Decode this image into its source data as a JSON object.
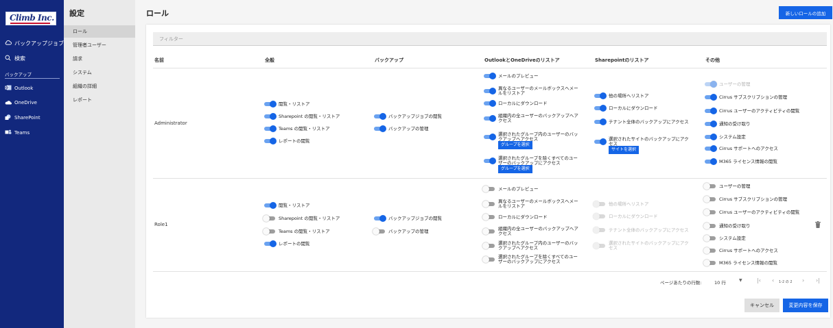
{
  "sidebar": {
    "logo_text": "Climb Inc.",
    "nav": [
      {
        "label": "バックアップジョブ",
        "icon": "cloud-sync-icon"
      },
      {
        "label": "検索",
        "icon": "search-icon"
      }
    ],
    "section_label": "バックアップ",
    "services": [
      {
        "label": "Outlook",
        "icon": "outlook-icon"
      },
      {
        "label": "OneDrive",
        "icon": "onedrive-icon"
      },
      {
        "label": "SharePoint",
        "icon": "sharepoint-icon"
      },
      {
        "label": "Teams",
        "icon": "teams-icon"
      }
    ]
  },
  "subnav": {
    "title": "設定",
    "items": [
      {
        "label": "ロール",
        "active": true
      },
      {
        "label": "管理者ユーザー"
      },
      {
        "label": "請求"
      },
      {
        "label": "システム"
      },
      {
        "label": "組織の詳細"
      },
      {
        "label": "レポート"
      }
    ]
  },
  "main": {
    "title": "ロール",
    "add_role_label": "新しいロールの追加",
    "filter_placeholder": "フィルター",
    "columns": [
      "名前",
      "全般",
      "バックアップ",
      "OutlookとOneDriveのリストア",
      "Sharepointのリストア",
      "その他"
    ],
    "roles": [
      {
        "name": "Administrator",
        "general": [
          {
            "label": "閲覧・リストア",
            "on": true
          },
          {
            "label": "Sharepoint の閲覧・リストア",
            "on": true
          },
          {
            "label": "Teams の閲覧・リストア",
            "on": true
          },
          {
            "label": "レポートの閲覧",
            "on": true
          }
        ],
        "backup": [
          {
            "label": "バックアップジョブの閲覧",
            "on": true
          },
          {
            "label": "バックアップの管理",
            "on": true
          }
        ],
        "outlook": [
          {
            "label": "メールのプレビュー",
            "on": true
          },
          {
            "label": "異なるユーザーのメールボックスへメールをリストア",
            "on": true
          },
          {
            "label": "ローカルにダウンロード",
            "on": true
          },
          {
            "label": "組織内の全ユーザーのバックアップへアクセス",
            "on": true
          },
          {
            "label": "選択されたグループ内のユーザーのバックアップへアクセス",
            "on": true,
            "button": "グループを選択"
          },
          {
            "label": "選択されたグループを除くすべてのユーザーのバックアップにアクセス",
            "on": true,
            "button": "グループを選択"
          }
        ],
        "sharepoint": [
          {
            "label": "他の場所へリストア",
            "on": true
          },
          {
            "label": "ローカルにダウンロード",
            "on": true
          },
          {
            "label": "テナント全体のバックアップにアクセス",
            "on": true
          },
          {
            "label": "選択されたサイトのバックアップにアクセス",
            "on": true,
            "button": "サイトを選択"
          }
        ],
        "other": [
          {
            "label": "ユーザーの管理",
            "on": true,
            "disabled": true
          },
          {
            "label": "Cirrus サブスクリプションの管理",
            "on": true
          },
          {
            "label": "Cirrus ユーザーのアクティビティの閲覧",
            "on": true
          },
          {
            "label": "通知の受け取り",
            "on": true
          },
          {
            "label": "システム設定",
            "on": true
          },
          {
            "label": "Cirrus サポートへのアクセス",
            "on": true
          },
          {
            "label": "M365 ライセンス情報の閲覧",
            "on": true
          }
        ]
      },
      {
        "name": "Role1",
        "general": [
          {
            "label": "閲覧・リストア",
            "on": true
          },
          {
            "label": "Sharepoint の閲覧・リストア",
            "on": false
          },
          {
            "label": "Teams の閲覧・リストア",
            "on": false
          },
          {
            "label": "レポートの閲覧",
            "on": true
          }
        ],
        "backup": [
          {
            "label": "バックアップジョブの閲覧",
            "on": true
          },
          {
            "label": "バックアップの管理",
            "on": false
          }
        ],
        "outlook": [
          {
            "label": "メールのプレビュー",
            "on": false
          },
          {
            "label": "異なるユーザーのメールボックスへメールをリストア",
            "on": false
          },
          {
            "label": "ローカルにダウンロード",
            "on": false
          },
          {
            "label": "組織内の全ユーザーのバックアップへアクセス",
            "on": false
          },
          {
            "label": "選択されたグループ内のユーザーのバックアップへアクセス",
            "on": false
          },
          {
            "label": "選択されたグループを除くすべてのユーザーのバックアップにアクセス",
            "on": false
          }
        ],
        "sharepoint": [
          {
            "label": "他の場所へリストア",
            "on": false,
            "disabled": true
          },
          {
            "label": "ローカルにダウンロード",
            "on": false,
            "disabled": true
          },
          {
            "label": "テナント全体のバックアップにアクセス",
            "on": false,
            "disabled": true
          },
          {
            "label": "選択されたサイトのバックアップにアクセス",
            "on": false,
            "disabled": true
          }
        ],
        "other": [
          {
            "label": "ユーザーの管理",
            "on": false
          },
          {
            "label": "Cirrus サブスクリプションの管理",
            "on": false
          },
          {
            "label": "Cirrus ユーザーのアクティビティの閲覧",
            "on": false
          },
          {
            "label": "通知の受け取り",
            "on": false
          },
          {
            "label": "システム設定",
            "on": false
          },
          {
            "label": "Cirrus サポートへのアクセス",
            "on": false
          },
          {
            "label": "M365 ライセンス情報の閲覧",
            "on": false
          }
        ]
      }
    ],
    "pagination": {
      "rows_label": "ページあたりの行数:",
      "rows_value": "10 行",
      "range": "1-2 の 2"
    },
    "cancel_label": "キャンセル",
    "save_label": "変更内容を保存"
  },
  "colors": {
    "sidebar_bg": "#12287d",
    "accent": "#1565e6",
    "toggle_on_track": "#6aa2f0",
    "toggle_off_track": "#9e9e9e"
  }
}
